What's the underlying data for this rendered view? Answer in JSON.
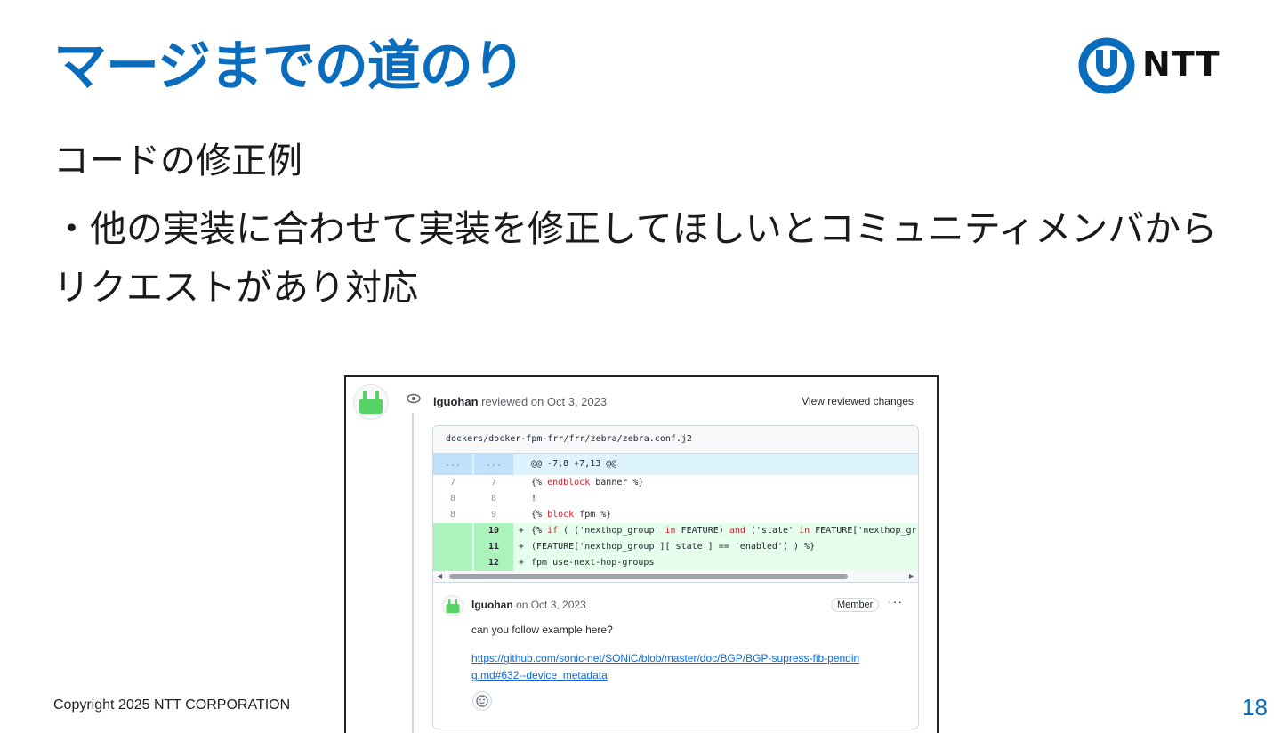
{
  "slide": {
    "title": "マージまでの道のり",
    "subheading": "コードの修正例",
    "body": "・他の実装に合わせて実装を修正してほしいとコミュニティメンバからリクエストがあり対応",
    "copyright": "Copyright 2025 NTT CORPORATION",
    "page_number": "18",
    "logo_text": "NTT",
    "accent_color": "#0a6cbd"
  },
  "review": {
    "author": "lguohan",
    "action_text": "reviewed on Oct 3, 2023",
    "view_changes_label": "View reviewed changes",
    "file_path": "dockers/docker-fpm-frr/frr/zebra/zebra.conf.j2",
    "hunk": {
      "old_ellipsis": "...",
      "new_ellipsis": "...",
      "header": "@@ -7,8 +7,13 @@"
    },
    "diff_lines": [
      {
        "old": "7",
        "new": "7",
        "marker": "",
        "code": "{% endblock banner %}"
      },
      {
        "old": "8",
        "new": "8",
        "marker": "",
        "code": "!"
      },
      {
        "old": "8",
        "new": "9",
        "marker": "",
        "code": "{% block fpm %}"
      },
      {
        "old": "",
        "new": "10",
        "marker": "+",
        "code": "{% if ( ('nexthop_group' in FEATURE) and ('state' in  FEATURE['nexthop_gr"
      },
      {
        "old": "",
        "new": "11",
        "marker": "+",
        "code": "       (FEATURE['nexthop_group']['state'] == 'enabled') ) %}"
      },
      {
        "old": "",
        "new": "12",
        "marker": "+",
        "code": "fpm use-next-hop-groups"
      }
    ],
    "comment": {
      "author": "lguohan",
      "date_text": "on Oct 3, 2023",
      "badge": "Member",
      "more_label": "···",
      "body": "can you follow example here?",
      "link": "https://github.com/sonic-net/SONiC/blob/master/doc/BGP/BGP-supress-fib-pending.md#632--device_metadata"
    }
  }
}
